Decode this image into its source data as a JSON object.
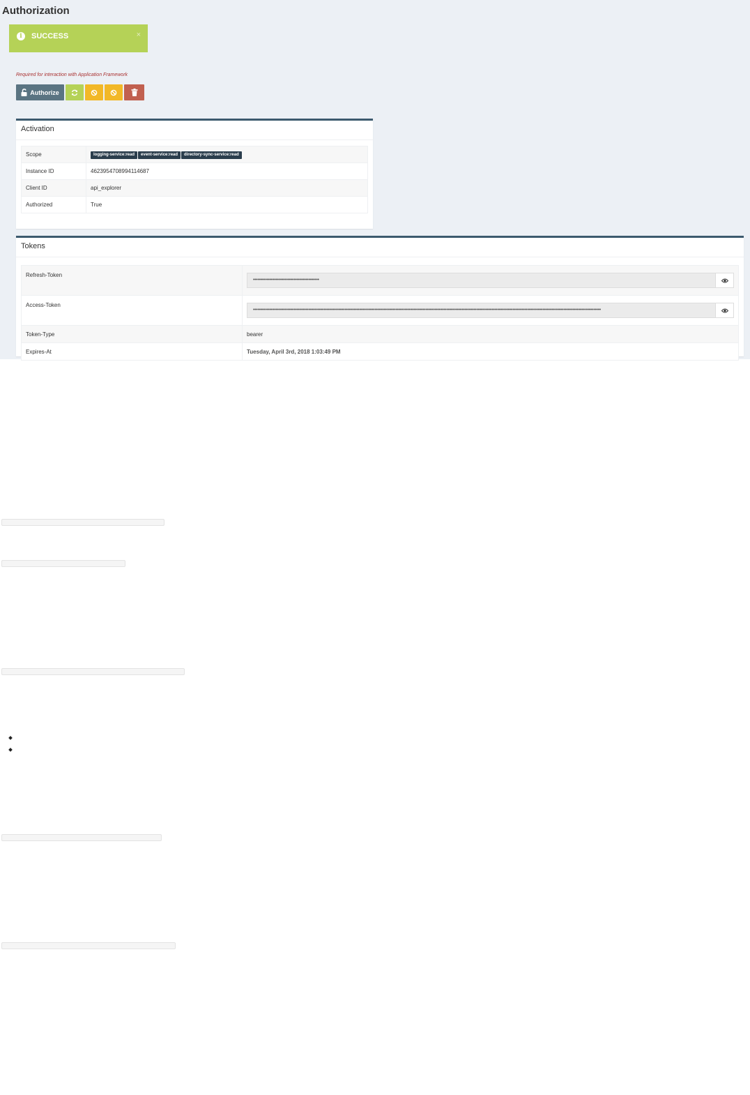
{
  "page": {
    "title": "Authorization"
  },
  "alert": {
    "text": "SUCCESS",
    "close": "×",
    "icon": "info-icon",
    "color": "#b5d257"
  },
  "hint": "Required for interaction with Application Framework",
  "toolbar": {
    "authorize_label": "Authorize",
    "buttons": [
      {
        "name": "authorize",
        "icon": "unlock-icon",
        "color": "#5a7482"
      },
      {
        "name": "refresh",
        "icon": "refresh-icon",
        "color": "#b5d257"
      },
      {
        "name": "revoke",
        "icon": "ban-icon",
        "color": "#f2b827"
      },
      {
        "name": "revoke",
        "icon": "ban-icon",
        "color": "#f2b827"
      },
      {
        "name": "delete",
        "icon": "trash-icon",
        "color": "#c1604f"
      }
    ]
  },
  "activation": {
    "title": "Activation",
    "scope_label": "Scope",
    "scopes": [
      "logging-service:read",
      "event-service:read",
      "directory-sync-service:read"
    ],
    "instance_label": "Instance ID",
    "instance_value": "4623954708994114687",
    "client_label": "Client ID",
    "client_value": "api_explorer",
    "authorized_label": "Authorized",
    "authorized_value": "True"
  },
  "tokens": {
    "title": "Tokens",
    "refresh_label": "Refresh-Token",
    "refresh_value": "••••••••••••••••••••••••••••••••••••••••••••",
    "access_label": "Access-Token",
    "access_value": "••••••••••••••••••••••••••••••••••••••••••••••••••••••••••••••••••••••••••••••••••••••••••••••••••••••••••••••••••••••••••••••••••••••••••••••••••••••••••••••••••••••••••••••••••••••••••••••••••••••••••••••••••••••••••••••••••••••••",
    "type_label": "Token-Type",
    "type_value": "bearer",
    "expires_label": "Expires-At",
    "expires_value": "Tuesday, April 3rd, 2018 1:03:49 PM"
  },
  "colors": {
    "panel_border": "#3c5a6e",
    "tag_bg": "#2b3e4d",
    "background": "#ecf0f5"
  }
}
